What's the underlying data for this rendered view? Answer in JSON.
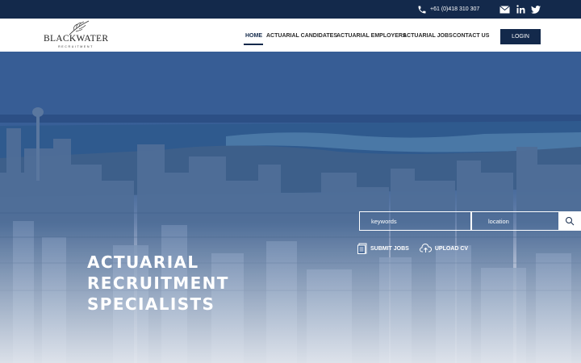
{
  "topbar": {
    "phone": "+61 (0)418 310 307",
    "icons": [
      "phone-icon",
      "mail-icon",
      "linkedin-icon",
      "twitter-icon"
    ]
  },
  "brand": {
    "name": "BLACKWATER",
    "tagline": "RECRUITMENT"
  },
  "nav": {
    "items": [
      {
        "label": "HOME",
        "active": true
      },
      {
        "label": "ACTUARIAL CANDIDATES"
      },
      {
        "label": "ACTUARIAL EMPLOYERS"
      },
      {
        "label": "ACTUARIAL JOBS"
      },
      {
        "label": "CONTACT US"
      }
    ],
    "login_label": "LOGIN"
  },
  "hero": {
    "title_lines": [
      "ACTUARIAL",
      "RECRUITMENT",
      "SPECIALISTS"
    ]
  },
  "search": {
    "keywords_placeholder": "keywords",
    "location_placeholder": "location"
  },
  "actions": {
    "submit_jobs": "SUBMIT JOBS",
    "upload_cv": "UPLOAD CV"
  },
  "colors": {
    "navy": "#13294b",
    "white": "#ffffff"
  }
}
